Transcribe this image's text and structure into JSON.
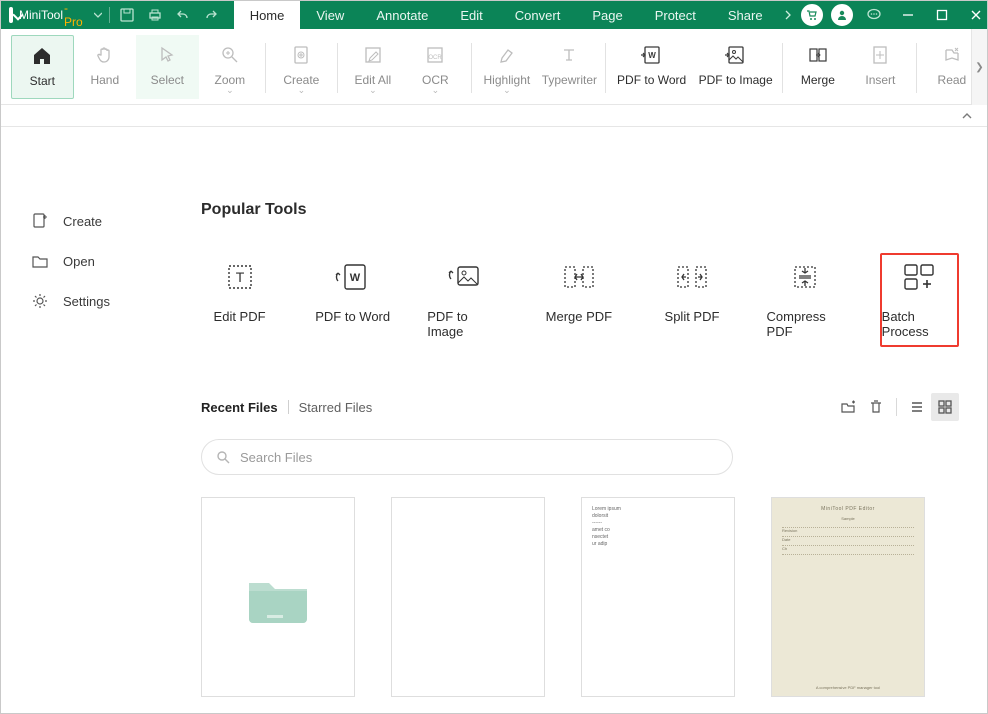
{
  "app": {
    "name": "MiniTool",
    "suffix": "-Pro"
  },
  "menus": [
    "Home",
    "View",
    "Annotate",
    "Edit",
    "Convert",
    "Page",
    "Protect",
    "Share"
  ],
  "active_menu": 0,
  "ribbon": [
    {
      "label": "Start",
      "enabled": true,
      "active": true
    },
    {
      "label": "Hand",
      "enabled": false
    },
    {
      "label": "Select",
      "enabled": false,
      "sel": true
    },
    {
      "label": "Zoom",
      "enabled": false,
      "sub": true
    },
    {
      "label": "Create",
      "enabled": false,
      "sub": true
    },
    {
      "label": "Edit All",
      "enabled": false,
      "sub": true
    },
    {
      "label": "OCR",
      "enabled": false,
      "sub": true
    },
    {
      "label": "Highlight",
      "enabled": false,
      "sub": true
    },
    {
      "label": "Typewriter",
      "enabled": false
    },
    {
      "label": "PDF to Word",
      "enabled": true,
      "wide": true
    },
    {
      "label": "PDF to Image",
      "enabled": true,
      "wide": true
    },
    {
      "label": "Merge",
      "enabled": true
    },
    {
      "label": "Insert",
      "enabled": false
    },
    {
      "label": "Read",
      "enabled": false
    }
  ],
  "sidebar": [
    {
      "label": "Create"
    },
    {
      "label": "Open"
    },
    {
      "label": "Settings"
    }
  ],
  "sections": {
    "popular": "Popular Tools"
  },
  "tools": [
    {
      "label": "Edit PDF"
    },
    {
      "label": "PDF to Word"
    },
    {
      "label": "PDF to Image"
    },
    {
      "label": "Merge PDF"
    },
    {
      "label": "Split PDF"
    },
    {
      "label": "Compress PDF"
    },
    {
      "label": "Batch Process",
      "boxed": true
    }
  ],
  "tabs": {
    "recent": "Recent Files",
    "starred": "Starred Files"
  },
  "search": {
    "placeholder": "Search Files"
  }
}
